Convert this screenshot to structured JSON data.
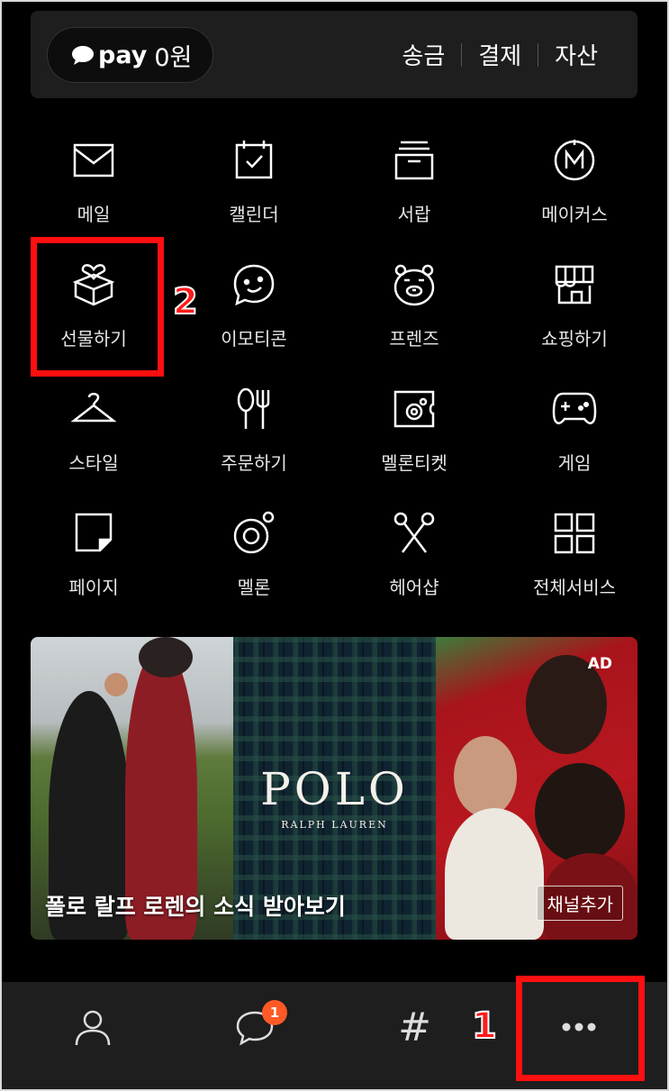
{
  "pay": {
    "logo": "pay",
    "amount": "0원",
    "links": [
      "송금",
      "결제",
      "자산"
    ]
  },
  "services": [
    {
      "label": "메일",
      "icon": "mail-icon"
    },
    {
      "label": "캘린더",
      "icon": "calendar-icon"
    },
    {
      "label": "서랍",
      "icon": "drawer-icon"
    },
    {
      "label": "메이커스",
      "icon": "makers-icon"
    },
    {
      "label": "선물하기",
      "icon": "gift-icon"
    },
    {
      "label": "이모티콘",
      "icon": "emoticon-icon"
    },
    {
      "label": "프렌즈",
      "icon": "friends-icon"
    },
    {
      "label": "쇼핑하기",
      "icon": "shopping-icon"
    },
    {
      "label": "스타일",
      "icon": "hanger-icon"
    },
    {
      "label": "주문하기",
      "icon": "utensils-icon"
    },
    {
      "label": "멜론티켓",
      "icon": "melon-ticket-icon"
    },
    {
      "label": "게임",
      "icon": "gamepad-icon"
    },
    {
      "label": "페이지",
      "icon": "page-icon"
    },
    {
      "label": "멜론",
      "icon": "melon-icon"
    },
    {
      "label": "헤어샵",
      "icon": "scissors-icon"
    },
    {
      "label": "전체서비스",
      "icon": "grid-icon"
    }
  ],
  "ad": {
    "badge": "AD",
    "logo": "POLO",
    "logo_sub": "RALPH LAUREN",
    "caption": "폴로 랄프 로렌의 소식 받아보기",
    "button": "채널추가"
  },
  "bottom_nav": [
    {
      "icon": "person-icon"
    },
    {
      "icon": "chat-icon",
      "badge": "1"
    },
    {
      "icon": "hashtag-icon",
      "text": "#"
    },
    {
      "icon": "more-icon"
    }
  ],
  "annotations": [
    {
      "label": "1",
      "target": "more-icon",
      "color": "#ff0f0f"
    },
    {
      "label": "2",
      "target": "gift-icon",
      "color": "#ff0f0f"
    }
  ]
}
